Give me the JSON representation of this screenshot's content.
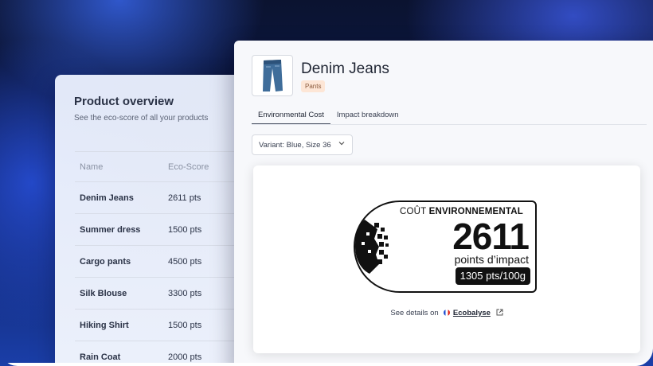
{
  "overview": {
    "title": "Product overview",
    "subtitle": "See the eco-score of all your products",
    "columns": [
      "Name",
      "Eco-Score"
    ],
    "rows": [
      {
        "name": "Denim Jeans",
        "score": "2611 pts"
      },
      {
        "name": "Summer dress",
        "score": "1500 pts"
      },
      {
        "name": "Cargo pants",
        "score": "4500 pts"
      },
      {
        "name": "Silk Blouse",
        "score": "3300 pts"
      },
      {
        "name": "Hiking Shirt",
        "score": "1500 pts"
      },
      {
        "name": "Rain Coat",
        "score": "2000 pts"
      }
    ]
  },
  "product": {
    "name": "Denim Jeans",
    "category": "Pants",
    "tabs": [
      "Environmental Cost",
      "Impact breakdown"
    ],
    "active_tab": "Environmental Cost",
    "variant": "Variant: Blue, Size 36"
  },
  "label": {
    "title_prefix": "COÛT",
    "title_suffix": "ENVIRONNEMENTAL",
    "value": "2611",
    "unit": "points d’impact",
    "per_weight": "1305 pts/100g"
  },
  "details": {
    "prefix": "See details on",
    "link": "Ecobalyse"
  },
  "icons": {
    "thumbnail": "jeans-image",
    "chevron": "chevron-down-icon",
    "flag": "french-flag-icon",
    "external": "external-link-icon"
  },
  "colors": {
    "badge_bg": "#fde6d6",
    "badge_text": "#8a5a3c",
    "accent_bg": "#1a3ea8"
  }
}
